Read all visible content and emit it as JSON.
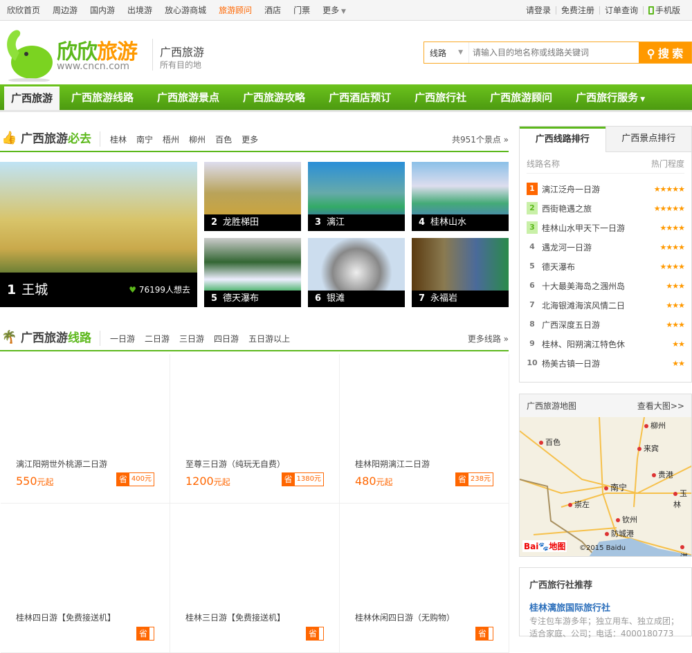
{
  "topbar": {
    "left": [
      "欣欣首页",
      "周边游",
      "国内游",
      "出境游",
      "放心游商城",
      "旅游顾问",
      "酒店",
      "门票",
      "更多"
    ],
    "active_index": 5,
    "right": [
      "请登录",
      "免费注册",
      "订单查询",
      "手机版"
    ]
  },
  "header": {
    "brand_green": "欣欣",
    "brand_orange": "旅游",
    "url": "www.cncn.com",
    "city": "广西旅游",
    "city_sub": "所有目的地",
    "search_type": "线路",
    "search_placeholder": "请输入目的地名称或线路关键词",
    "search_button": "搜 索"
  },
  "nav": [
    "广西旅游",
    "广西旅游线路",
    "广西旅游景点",
    "广西旅游攻略",
    "广西酒店预订",
    "广西旅行社",
    "广西旅游顾问",
    "广西旅行服务"
  ],
  "must_go": {
    "title_a": "广西旅游",
    "title_b": "必去",
    "tags": [
      "桂林",
      "南宁",
      "梧州",
      "柳州",
      "百色",
      "更多"
    ],
    "more": "共951个景点",
    "featured": {
      "rank": "1",
      "name": "王城",
      "wants": "76199人想去"
    },
    "spots": [
      {
        "rank": "2",
        "name": "龙胜梯田"
      },
      {
        "rank": "3",
        "name": "漓江"
      },
      {
        "rank": "4",
        "name": "桂林山水"
      },
      {
        "rank": "5",
        "name": "德天瀑布"
      },
      {
        "rank": "6",
        "name": "银滩"
      },
      {
        "rank": "7",
        "name": "永福岩"
      }
    ]
  },
  "routes": {
    "title_a": "广西旅游",
    "title_b": "线路",
    "tags": [
      "一日游",
      "二日游",
      "三日游",
      "四日游",
      "五日游以上"
    ],
    "more": "更多线路",
    "save_label": "省",
    "price_suffix": "元起",
    "items": [
      {
        "name": "漓江阳朔世外桃源二日游",
        "price": "550",
        "save": "400元"
      },
      {
        "name": "至尊三日游（纯玩无自费）",
        "price": "1200",
        "save": "1380元"
      },
      {
        "name": "桂林阳朔漓江二日游",
        "price": "480",
        "save": "238元"
      },
      {
        "name": "桂林四日游【免费接送机】",
        "price": "",
        "save": ""
      },
      {
        "name": "桂林三日游【免费接送机】",
        "price": "",
        "save": ""
      },
      {
        "name": "桂林休闲四日游（无购物）",
        "price": "",
        "save": ""
      }
    ]
  },
  "ranking": {
    "tabs": [
      "广西线路排行",
      "广西景点排行"
    ],
    "col_name": "线路名称",
    "col_hot": "热门程度",
    "items": [
      {
        "no": "1",
        "name": "漓江泛舟一日游",
        "stars": 5
      },
      {
        "no": "2",
        "name": "西街艳遇之旅",
        "stars": 5
      },
      {
        "no": "3",
        "name": "桂林山水甲天下一日游",
        "stars": 4
      },
      {
        "no": "4",
        "name": "遇龙河一日游",
        "stars": 4
      },
      {
        "no": "5",
        "name": "德天瀑布",
        "stars": 4
      },
      {
        "no": "6",
        "name": "十大最美海岛之涠州岛",
        "stars": 3
      },
      {
        "no": "7",
        "name": "北海银滩海滨风情二日",
        "stars": 3
      },
      {
        "no": "8",
        "name": "广西深度五日游",
        "stars": 3
      },
      {
        "no": "9",
        "name": "桂林、阳朔漓江特色休",
        "stars": 2
      },
      {
        "no": "10",
        "name": "杨美古镇一日游",
        "stars": 2
      }
    ]
  },
  "map": {
    "title": "广西旅游地图",
    "more": "查看大图>>",
    "cities": [
      "柳州",
      "百色",
      "来宾",
      "贵港",
      "南宁",
      "玉林",
      "崇左",
      "钦州",
      "防城港",
      "湛"
    ],
    "logo": "Bai地图",
    "copyright": "©2015 Baidu"
  },
  "agency": {
    "title": "广西旅行社推荐",
    "name": "桂林漓旅国际旅行社",
    "desc": "专注包车游多年；独立用车、独立成团；适合家庭、公司；电话：4000180773"
  },
  "colors": {
    "green": "#5cb81b",
    "orange": "#ff6600",
    "search_orange": "#ff9900"
  }
}
